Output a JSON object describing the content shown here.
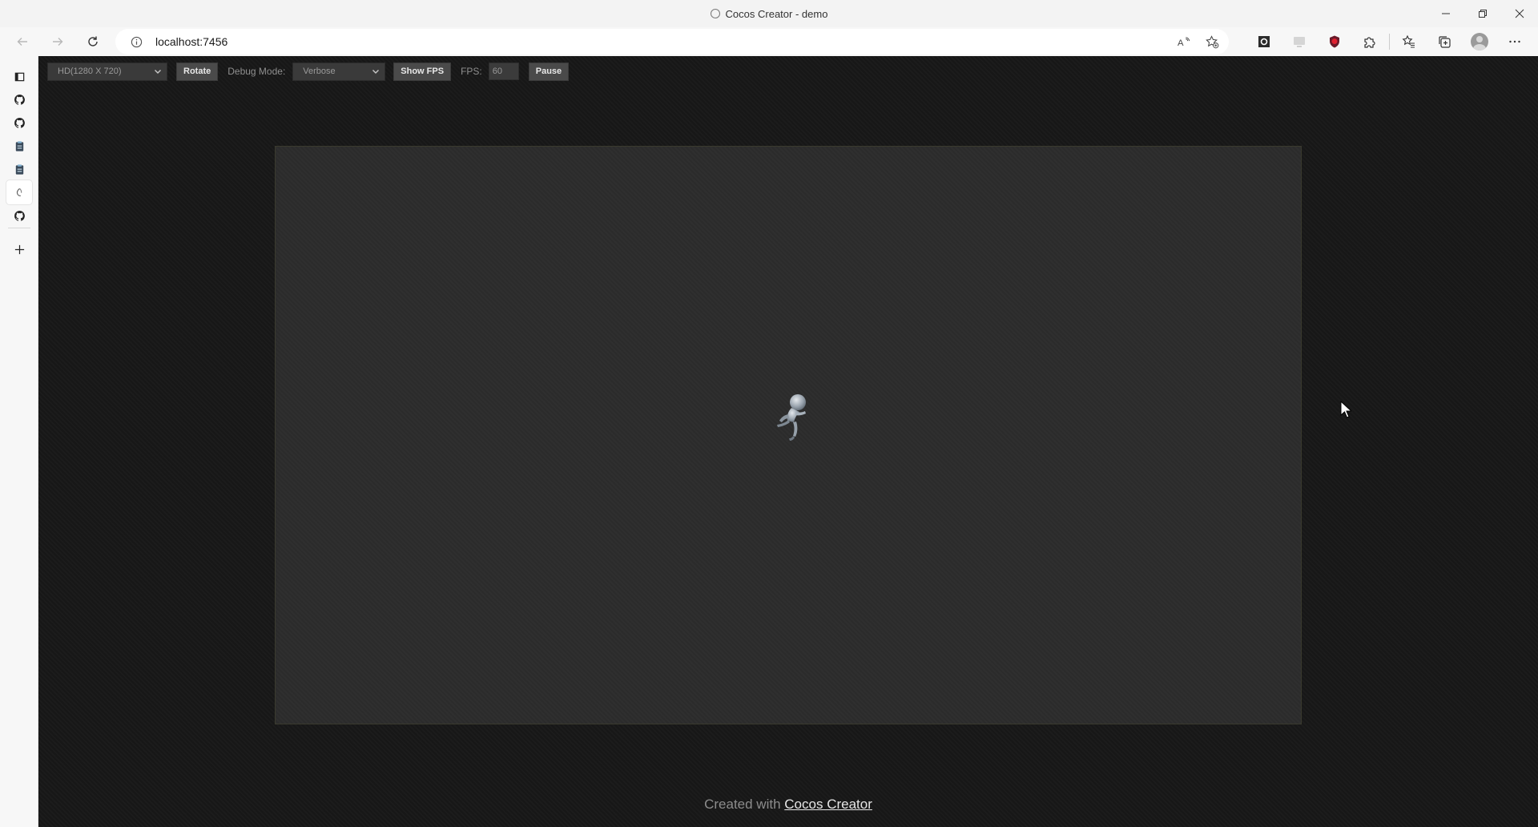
{
  "window": {
    "title": "Cocos Creator - demo"
  },
  "address_bar": {
    "url": "localhost:7456"
  },
  "dev_toolbar": {
    "resolution_selected": "HD(1280 X 720)",
    "rotate_label": "Rotate",
    "debug_mode_label": "Debug Mode:",
    "debug_mode_selected": "Verbose",
    "show_fps_label": "Show FPS",
    "fps_label": "FPS:",
    "fps_value": "60",
    "pause_label": "Pause"
  },
  "footer": {
    "prefix": "Created with",
    "link_text": "Cocos Creator"
  },
  "tabs": [
    {
      "icon": "tab-actions-icon"
    },
    {
      "icon": "github-icon"
    },
    {
      "icon": "github-icon"
    },
    {
      "icon": "clipboard-icon"
    },
    {
      "icon": "clipboard-icon"
    },
    {
      "icon": "cocos-icon",
      "active": true
    },
    {
      "icon": "github-icon"
    }
  ],
  "colors": {
    "page_background": "#171717",
    "canvas_background": "#2b2b2b",
    "button_background": "#4a4a4a"
  }
}
